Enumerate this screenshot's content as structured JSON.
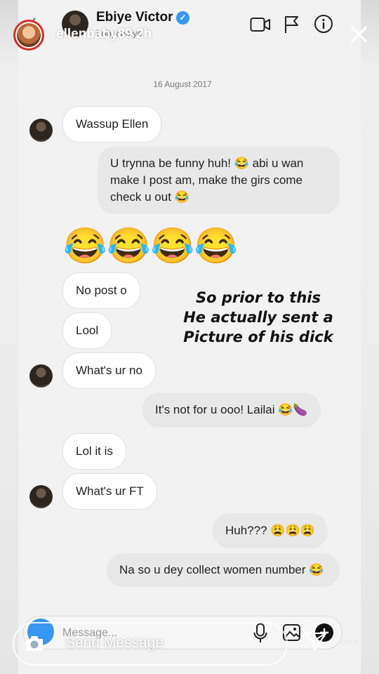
{
  "story": {
    "username": "ellenbaby89  2h",
    "reply_placeholder": "Send Message",
    "more_label": "···"
  },
  "dm_header": {
    "name": "Ebiye Victor",
    "username": "bobycebiye",
    "back_glyph": "‹"
  },
  "conversation": {
    "date": "16 August 2017",
    "messages": [
      {
        "side": "in",
        "text": "Wassup Ellen"
      },
      {
        "side": "out",
        "text": "U trynna be funny huh! 😂 abi u wan make I post am, make the girs come check u out 😂"
      },
      {
        "side": "in",
        "text": "😂😂😂😂"
      },
      {
        "side": "in",
        "text": "No post o"
      },
      {
        "side": "in",
        "text": "Lool"
      },
      {
        "side": "in",
        "text": "What's ur no"
      },
      {
        "side": "out",
        "text": "It's not for u ooo! Lailai 😂🍆"
      },
      {
        "side": "in",
        "text": "Lol it is"
      },
      {
        "side": "in",
        "text": "What's ur FT"
      },
      {
        "side": "out",
        "text": "Huh??? 😩😩😩"
      },
      {
        "side": "out",
        "text": "Na so u dey collect women number 😂"
      }
    ]
  },
  "caption": {
    "line1": "So prior to this",
    "line2": "He actually sent a",
    "line3": "Picture of his dick"
  },
  "composer": {
    "placeholder": "Message..."
  },
  "colors": {
    "accent_blue": "#3897f0",
    "story_ring": "#d8322e"
  },
  "icons": [
    "close-icon",
    "video-call-icon",
    "flag-icon",
    "info-icon",
    "verified-icon",
    "camera-icon",
    "mic-icon",
    "gallery-icon",
    "plus-icon",
    "send-icon"
  ]
}
